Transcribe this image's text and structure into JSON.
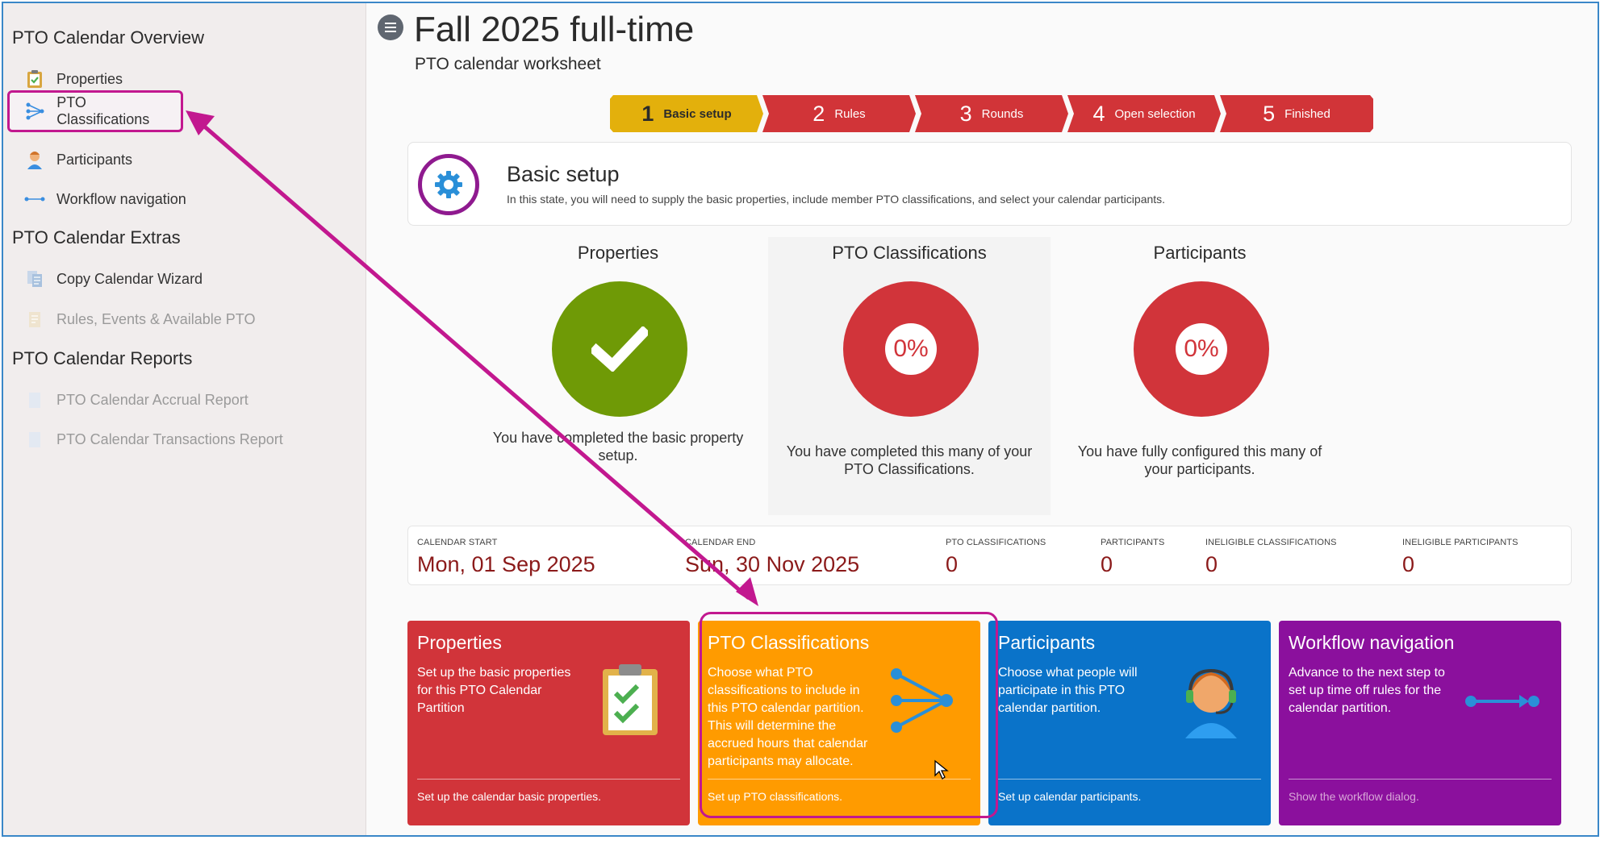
{
  "sidebar": {
    "sections": [
      "PTO Calendar Overview",
      "PTO Calendar Extras",
      "PTO Calendar Reports"
    ],
    "items": [
      {
        "label": "Properties",
        "icon": "clipboard-icon"
      },
      {
        "label": "PTO Classifications",
        "icon": "branch-icon"
      },
      {
        "label": "Participants",
        "icon": "person-icon"
      },
      {
        "label": "Workflow navigation",
        "icon": "workflow-icon"
      },
      {
        "label": "Copy Calendar Wizard",
        "icon": "copy-icon"
      },
      {
        "label": "Rules, Events & Available PTO",
        "icon": "rules-icon"
      },
      {
        "label": "PTO Calendar Accrual Report",
        "icon": "report-icon"
      },
      {
        "label": "PTO Calendar Transactions Report",
        "icon": "report-icon"
      }
    ]
  },
  "header": {
    "title": "Fall 2025 full-time",
    "subtitle": "PTO calendar worksheet"
  },
  "stepper": [
    {
      "num": "1",
      "label": "Basic setup",
      "active": true
    },
    {
      "num": "2",
      "label": "Rules"
    },
    {
      "num": "3",
      "label": "Rounds"
    },
    {
      "num": "4",
      "label": "Open selection"
    },
    {
      "num": "5",
      "label": "Finished"
    }
  ],
  "setup": {
    "title": "Basic setup",
    "description": "In this state, you will need to supply the basic properties, include member PTO classifications, and select your calendar participants."
  },
  "progress": [
    {
      "title": "Properties",
      "text": "You have completed the basic property setup.",
      "done": true
    },
    {
      "title": "PTO Classifications",
      "value": "0%",
      "text": "You have completed this many of your PTO Classifications."
    },
    {
      "title": "Participants",
      "value": "0%",
      "text": "You have fully configured this many of your participants."
    }
  ],
  "stats": [
    {
      "label": "CALENDAR START",
      "value": "Mon, 01 Sep 2025"
    },
    {
      "label": "CALENDAR END",
      "value": "Sun, 30 Nov 2025"
    },
    {
      "label": "PTO CLASSIFICATIONS",
      "value": "0"
    },
    {
      "label": "PARTICIPANTS",
      "value": "0"
    },
    {
      "label": "INELIGIBLE CLASSIFICATIONS",
      "value": "0"
    },
    {
      "label": "INELIGIBLE PARTICIPANTS",
      "value": "0"
    }
  ],
  "tiles": [
    {
      "title": "Properties",
      "desc": "Set up the basic properties for this PTO Calendar Partition",
      "foot": "Set up the calendar basic properties."
    },
    {
      "title": "PTO Classifications",
      "desc": "Choose what PTO classifications to include in this PTO calendar partition. This will determine the accrued hours that calendar participants may allocate.",
      "foot": "Set up PTO classifications."
    },
    {
      "title": "Participants",
      "desc": "Choose what people will participate in this PTO calendar partition.",
      "foot": "Set up calendar participants."
    },
    {
      "title": "Workflow navigation",
      "desc": "Advance to the next step to set up time off rules for the calendar partition.",
      "foot": "Show the workflow dialog."
    }
  ],
  "colors": {
    "accent_red": "#d1343a",
    "accent_yellow": "#e3b00c",
    "green": "#6f9a06",
    "orange": "#ff9b00",
    "blue": "#0a73c9",
    "purple": "#8b109d",
    "annotation": "#c2188f"
  }
}
